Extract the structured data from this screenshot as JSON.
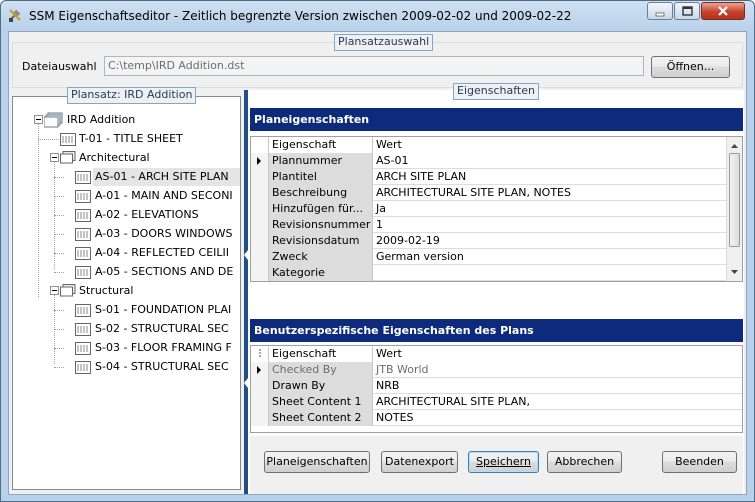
{
  "window": {
    "title": "SSM Eigenschaftseditor - Zeitlich begrenzte Version zwischen 2009-02-02 und 2009-02-22"
  },
  "planset_selection": {
    "group_label": "Plansatzauswahl",
    "file_label": "Dateiauswahl",
    "file_path": "C:\\temp\\IRD Addition.dst",
    "open_button": "Öffnen..."
  },
  "tree": {
    "group_label": "Plansatz: IRD Addition",
    "root": "IRD Addition",
    "title_sheet": "T-01 - TITLE SHEET",
    "architectural": {
      "label": "Architectural",
      "items": [
        "AS-01 - ARCH SITE PLAN",
        "A-01 - MAIN AND SECONI",
        "A-02 - ELEVATIONS",
        "A-03 - DOORS WINDOWS",
        "A-04 - REFLECTED CEILII",
        "A-05 - SECTIONS AND DE"
      ]
    },
    "structural": {
      "label": "Structural",
      "items": [
        "S-01 - FOUNDATION PLAI",
        "S-02 - STRUCTURAL SEC",
        "S-03 - FLOOR FRAMING F",
        "S-04 - STRUCTURAL SEC"
      ]
    }
  },
  "properties": {
    "group_label": "Eigenschaften",
    "plan_section": {
      "title": "Planeigenschaften",
      "col_property": "Eigenschaft",
      "col_value": "Wert",
      "rows": [
        {
          "name": "Plannummer",
          "value": "AS-01"
        },
        {
          "name": "Plantitel",
          "value": "ARCH SITE PLAN"
        },
        {
          "name": "Beschreibung",
          "value": "ARCHITECTURAL SITE PLAN, NOTES"
        },
        {
          "name": "Hinzufügen für...",
          "value": "Ja"
        },
        {
          "name": "Revisionsnummer",
          "value": "1"
        },
        {
          "name": "Revisionsdatum",
          "value": "2009-02-19"
        },
        {
          "name": "Zweck",
          "value": "German version"
        },
        {
          "name": "Kategorie",
          "value": ""
        }
      ]
    },
    "custom_section": {
      "title": "Benutzerspezifische Eigenschaften des Plans",
      "col_property": "Eigenschaft",
      "col_value": "Wert",
      "rows": [
        {
          "name": "Checked By",
          "value": "JTB World"
        },
        {
          "name": "Drawn By",
          "value": "NRB"
        },
        {
          "name": "Sheet Content 1",
          "value": "ARCHITECTURAL SITE PLAN,"
        },
        {
          "name": "Sheet Content 2",
          "value": "NOTES"
        }
      ]
    }
  },
  "buttons": {
    "plan_properties": "Planeigenschaften",
    "data_export": "Datenexport",
    "save": "Speichern",
    "cancel": "Abbrechen",
    "quit": "Beenden"
  },
  "colors": {
    "section_header": "#0e2a7a",
    "splitter": "#1f4f86",
    "name_column": "#dcdcdc",
    "window_frame": "#b9d1ea"
  }
}
